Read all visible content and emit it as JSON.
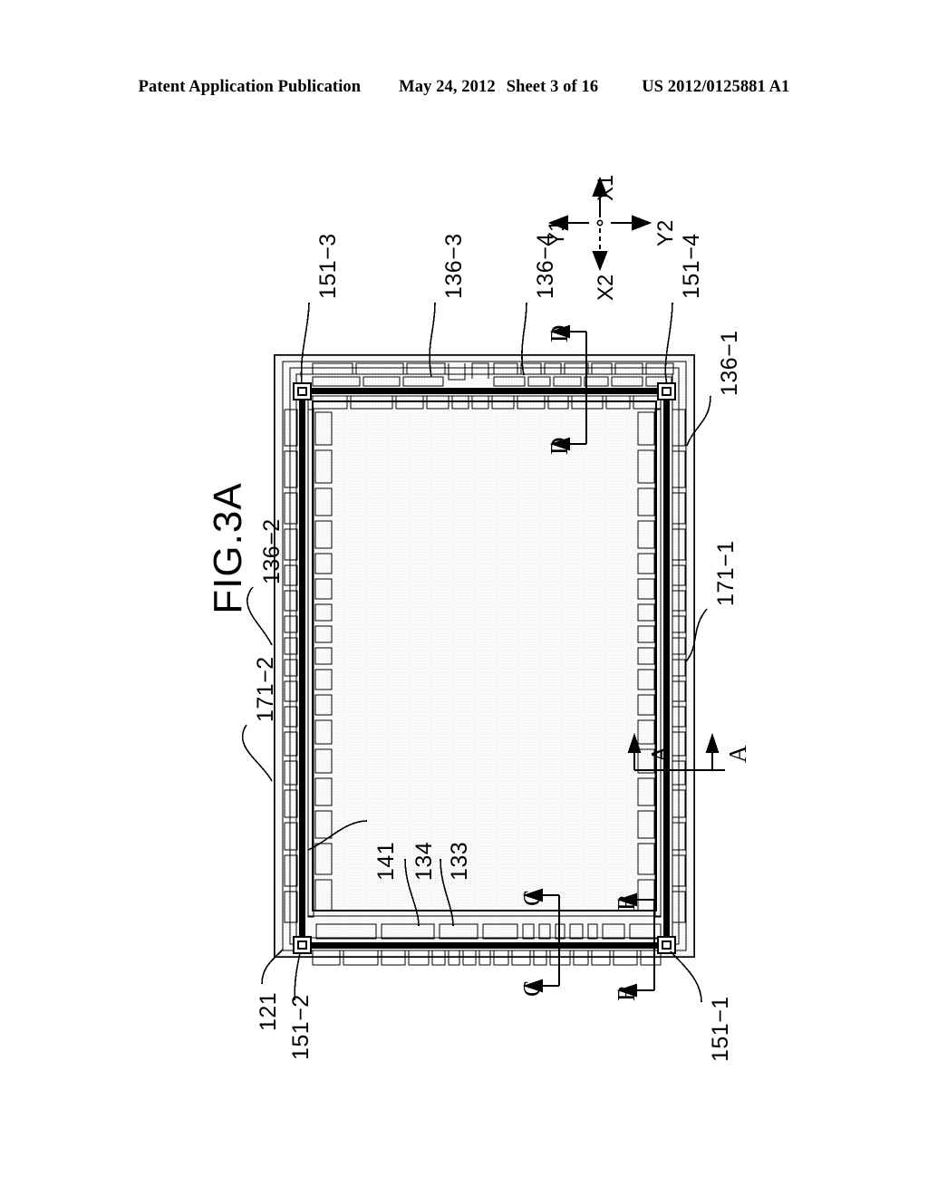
{
  "header": {
    "publication": "Patent Application Publication",
    "date": "May 24, 2012",
    "sheet": "Sheet 3 of 16",
    "patent_number": "US 2012/0125881 A1"
  },
  "figure": {
    "title": "FIG.3A",
    "reference_numerals": [
      {
        "id": "151-3",
        "label": "151−3"
      },
      {
        "id": "136-3",
        "label": "136−3"
      },
      {
        "id": "136-4",
        "label": "136−4"
      },
      {
        "id": "151-4",
        "label": "151−4"
      },
      {
        "id": "136-1",
        "label": "136−1"
      },
      {
        "id": "136-2",
        "label": "136−2"
      },
      {
        "id": "171-2",
        "label": "171−2"
      },
      {
        "id": "171-1",
        "label": "171−1"
      },
      {
        "id": "141",
        "label": "141"
      },
      {
        "id": "134",
        "label": "134"
      },
      {
        "id": "133",
        "label": "133"
      },
      {
        "id": "121",
        "label": "121"
      },
      {
        "id": "151-2",
        "label": "151−2"
      },
      {
        "id": "151-1",
        "label": "151−1"
      }
    ],
    "section_markers": [
      {
        "id": "A-top",
        "label": "A"
      },
      {
        "id": "A-bottom",
        "label": "A"
      },
      {
        "id": "B-top",
        "label": "B"
      },
      {
        "id": "B-bottom",
        "label": "B"
      },
      {
        "id": "C-top",
        "label": "C"
      },
      {
        "id": "C-bottom",
        "label": "C"
      },
      {
        "id": "D-top",
        "label": "D"
      },
      {
        "id": "D-bottom",
        "label": "D"
      }
    ],
    "axis_indicator": {
      "up": "X1",
      "down": "X2",
      "left": "Y1",
      "right": "Y2"
    },
    "colors": {
      "line": "#000000",
      "background": "#ffffff",
      "hatch": "#b0b0b0"
    }
  }
}
